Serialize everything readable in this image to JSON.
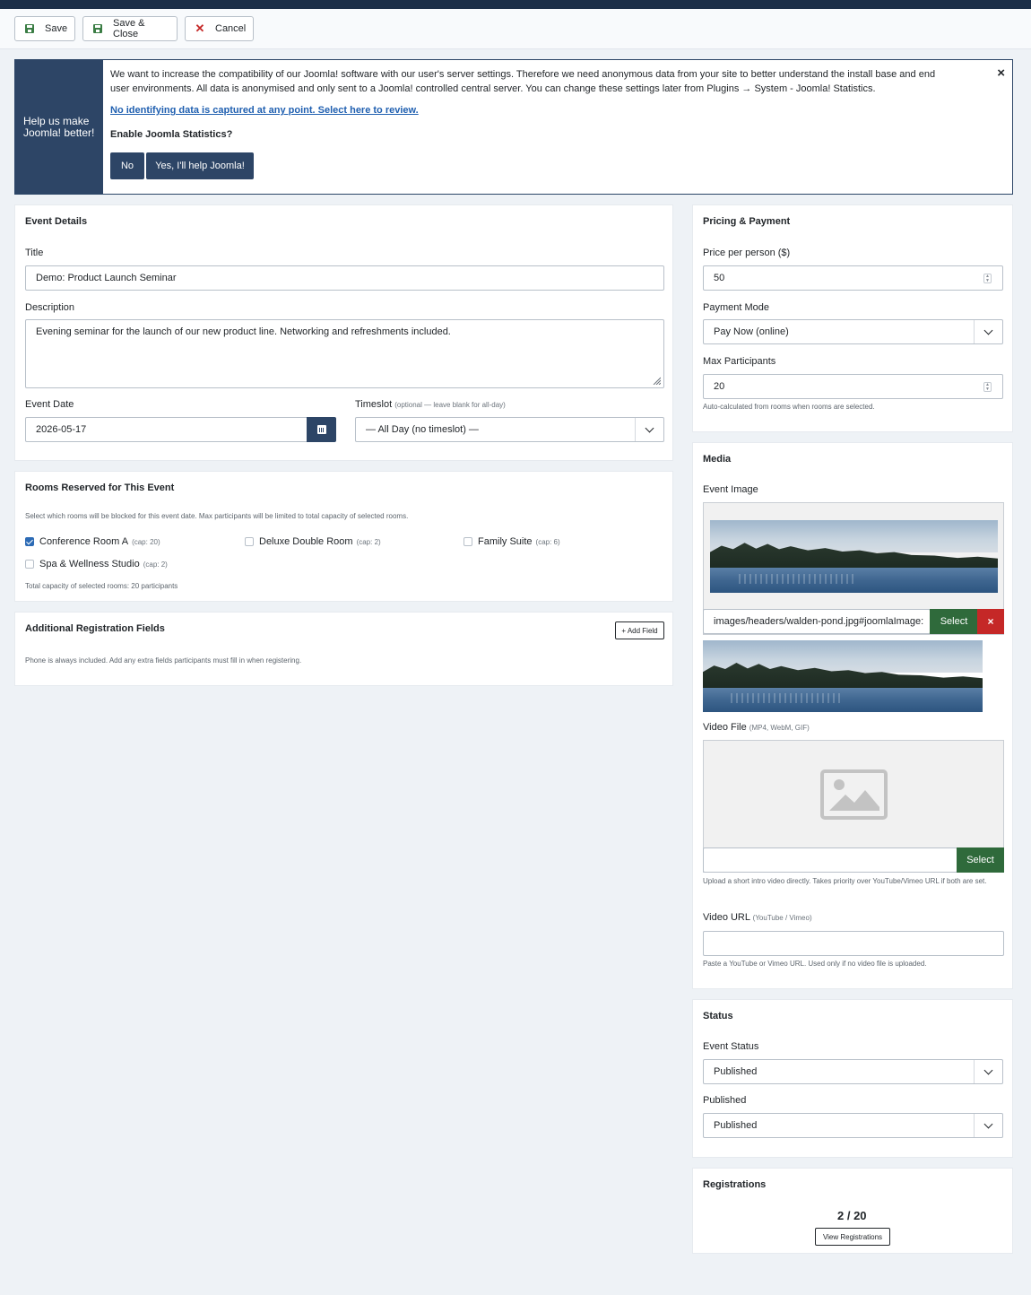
{
  "toolbar": {
    "save": "Save",
    "save_close": "Save & Close",
    "cancel": "Cancel"
  },
  "stats": {
    "side_title": "Help us make Joomla! better!",
    "message": "We want to increase the compatibility of our Joomla! software with our user's server settings. Therefore we need anonymous data from your site to better understand the install base and end user environments. All data is anonymised and only sent to a Joomla! controlled central server. You can change these settings later from Plugins → System - Joomla! Statistics.",
    "link": "No identifying data is captured at any point. Select here to review.",
    "question": "Enable Joomla Statistics?",
    "no": "No",
    "yes": "Yes, I'll help Joomla!",
    "close": "×"
  },
  "event_details": {
    "title": "Event Details",
    "title_label": "Title",
    "title_value": "Demo: Product Launch Seminar",
    "description_label": "Description",
    "description_value": "Evening seminar for the launch of our new product line. Networking and refreshments included.",
    "date_label": "Event Date",
    "date_value": "2026-05-17",
    "timeslot_label": "Timeslot",
    "timeslot_hint": "(optional — leave blank for all-day)",
    "timeslot_value": "— All Day (no timeslot) —"
  },
  "rooms": {
    "title": "Rooms Reserved for This Event",
    "help": "Select which rooms will be blocked for this event date. Max participants will be limited to total capacity of selected rooms.",
    "items": [
      {
        "name": "Conference Room A",
        "cap": "(cap: 20)",
        "checked": true
      },
      {
        "name": "Deluxe Double Room",
        "cap": "(cap: 2)",
        "checked": false
      },
      {
        "name": "Family Suite",
        "cap": "(cap: 6)",
        "checked": false
      },
      {
        "name": "Spa & Wellness Studio",
        "cap": "(cap: 2)",
        "checked": false
      }
    ],
    "total": "Total capacity of selected rooms: 20 participants"
  },
  "additional_fields": {
    "title": "Additional Registration Fields",
    "add_button": "+ Add Field",
    "help": "Phone is always included. Add any extra fields participants must fill in when registering."
  },
  "pricing": {
    "title": "Pricing & Payment",
    "price_label": "Price per person ($)",
    "price_value": "50",
    "mode_label": "Payment Mode",
    "mode_value": "Pay Now (online)",
    "max_label": "Max Participants",
    "max_value": "20",
    "max_help": "Auto-calculated from rooms when rooms are selected."
  },
  "media": {
    "title": "Media",
    "image_label": "Event Image",
    "image_path": "images/headers/walden-pond.jpg#joomlaImage:",
    "select": "Select",
    "clear": "×",
    "video_label": "Video File",
    "video_hint": "(MP4, WebM, GIF)",
    "video_value": "",
    "video_select": "Select",
    "video_help": "Upload a short intro video directly. Takes priority over YouTube/Vimeo URL if both are set.",
    "url_label": "Video URL",
    "url_hint": "(YouTube / Vimeo)",
    "url_value": "",
    "url_help": "Paste a YouTube or Vimeo URL. Used only if no video file is uploaded."
  },
  "status": {
    "title": "Status",
    "event_status_label": "Event Status",
    "event_status_value": "Published",
    "published_label": "Published",
    "published_value": "Published"
  },
  "registrations": {
    "title": "Registrations",
    "count": "2 / 20",
    "view_button": "View Registrations"
  },
  "colors": {
    "header": "#1c2f48",
    "primary": "#2d4566",
    "success": "#2f6a3b",
    "danger": "#c52827"
  }
}
